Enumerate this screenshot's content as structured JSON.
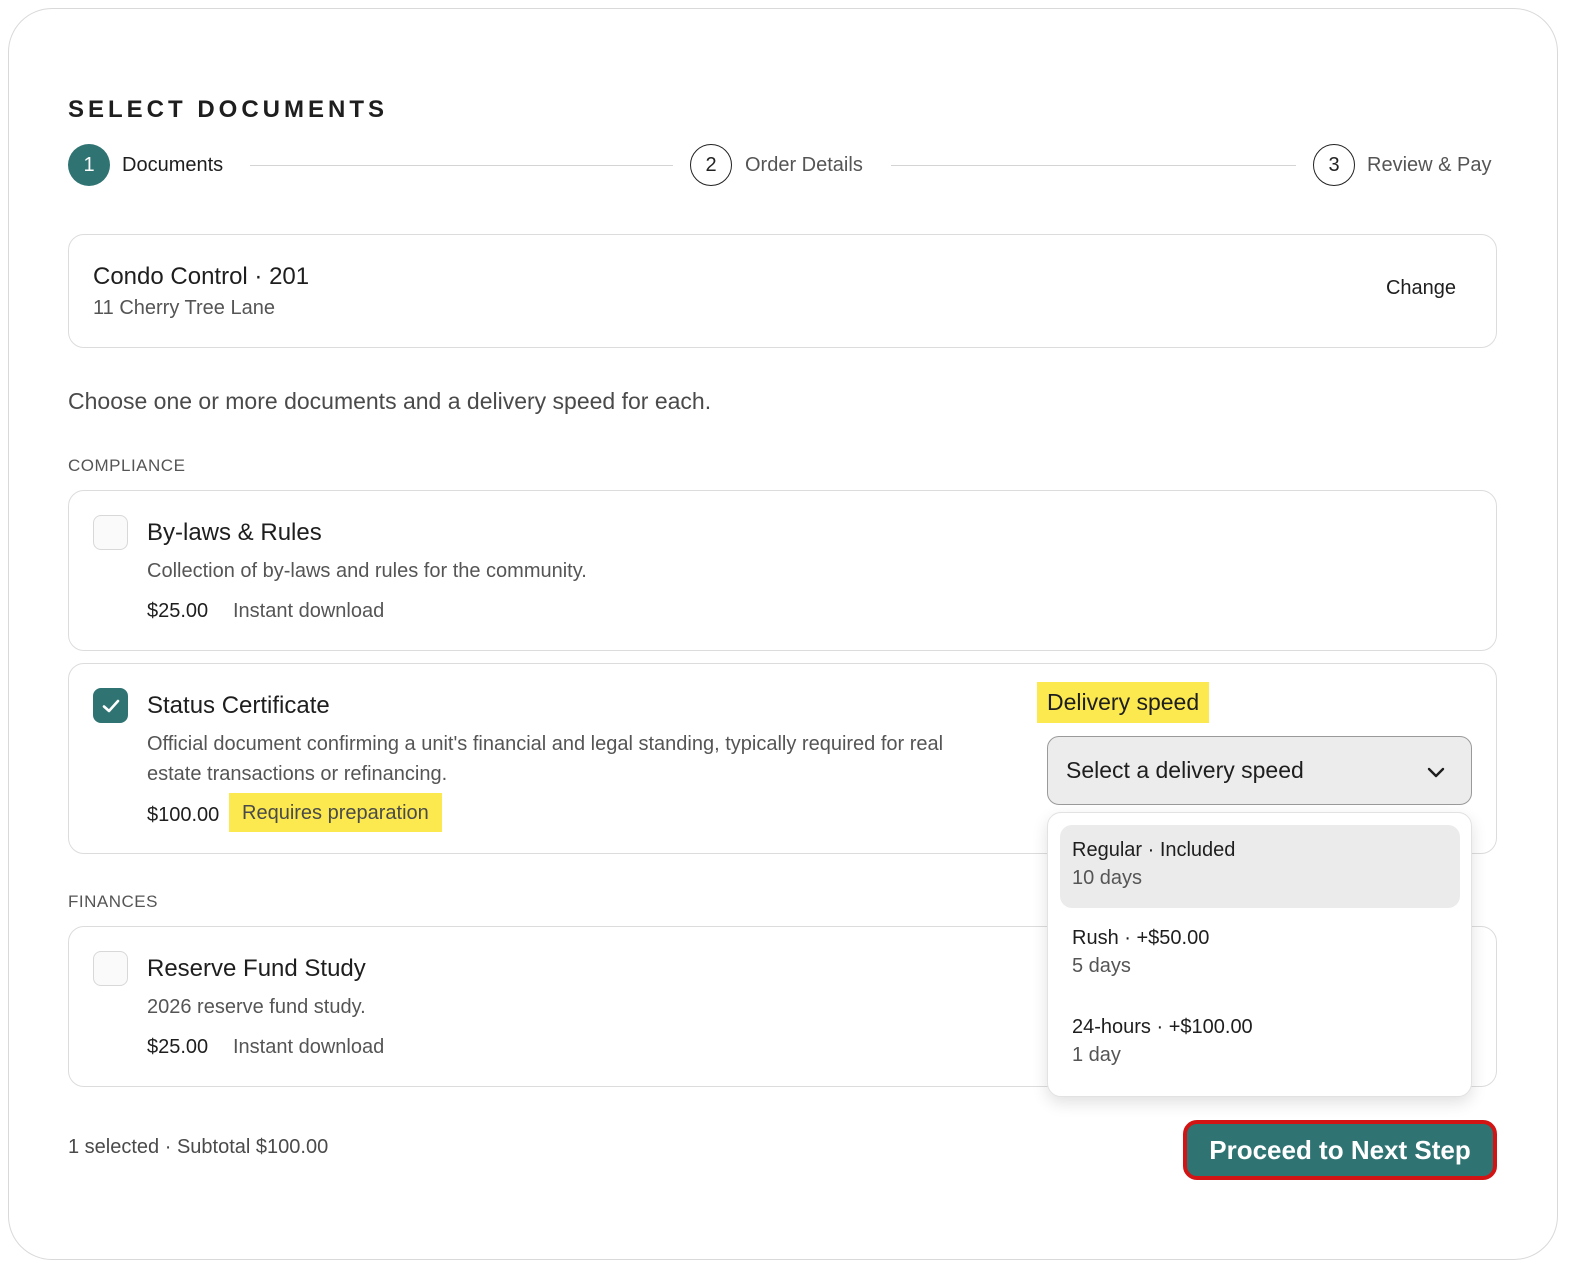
{
  "page": {
    "title": "SELECT DOCUMENTS"
  },
  "stepper": {
    "steps": [
      {
        "number": "1",
        "label": "Documents",
        "state": "active"
      },
      {
        "number": "2",
        "label": "Order Details",
        "state": "idle"
      },
      {
        "number": "3",
        "label": "Review & Pay",
        "state": "idle"
      }
    ]
  },
  "property": {
    "name": "Condo Control · 201",
    "address": "11 Cherry Tree Lane",
    "change_label": "Change"
  },
  "intro": "Choose one or more documents and a delivery speed for each.",
  "sections": {
    "compliance": "COMPLIANCE",
    "finances": "FINANCES"
  },
  "documents": [
    {
      "title": "By-laws & Rules",
      "description": "Collection of by-laws and rules for the community.",
      "price": "$25.00",
      "meta": "Instant download",
      "checked": false
    },
    {
      "title": "Status Certificate",
      "description_line1": "Official document confirming a unit's financial and legal standing, typically required for real",
      "description_line2": "estate transactions or refinancing.",
      "price": "$100.00",
      "meta": "Requires preparation",
      "checked": true
    },
    {
      "title": "Reserve Fund Study",
      "description": "2026 reserve fund study.",
      "price": "$25.00",
      "meta": "Instant download",
      "checked": false
    }
  ],
  "delivery": {
    "label": "Delivery speed",
    "placeholder": "Select a delivery speed",
    "options": [
      {
        "title": "Regular · Included",
        "subtitle": "10 days"
      },
      {
        "title": "Rush · +$50.00",
        "subtitle": "5 days"
      },
      {
        "title": "24-hours · +$100.00",
        "subtitle": "1 day"
      }
    ]
  },
  "footer": {
    "summary": "1 selected · Subtotal $100.00",
    "next_label": "Proceed to Next Step"
  },
  "colors": {
    "accent": "#2f7373",
    "highlight": "#fbe94f",
    "button_border": "#d31414"
  }
}
